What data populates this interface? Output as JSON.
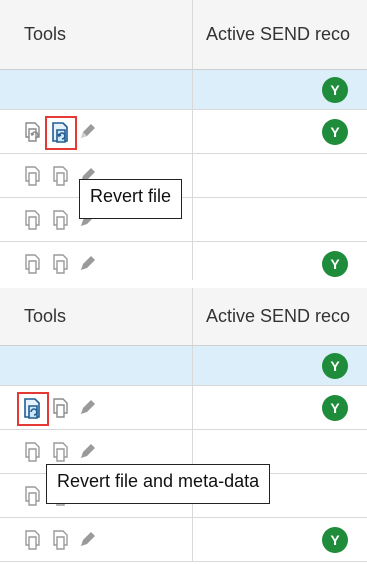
{
  "panels": [
    {
      "header": {
        "tools": "Tools",
        "active": "Active SEND reco"
      },
      "filter_badge": "Y",
      "rows": [
        {
          "badge": "Y",
          "highlight": "revert"
        },
        {
          "badge": ""
        },
        {
          "badge": ""
        },
        {
          "badge": "Y"
        }
      ],
      "tooltip": "Revert file"
    },
    {
      "header": {
        "tools": "Tools",
        "active": "Active SEND reco"
      },
      "filter_badge": "Y",
      "rows": [
        {
          "badge": "Y",
          "highlight": "revert-meta"
        },
        {
          "badge": ""
        },
        {
          "badge": ""
        },
        {
          "badge": "Y"
        }
      ],
      "tooltip": "Revert file and meta-data"
    }
  ],
  "colors": {
    "badge": "#1e8c3a",
    "highlight": "#e53935",
    "filter_row": "#dceefa"
  }
}
